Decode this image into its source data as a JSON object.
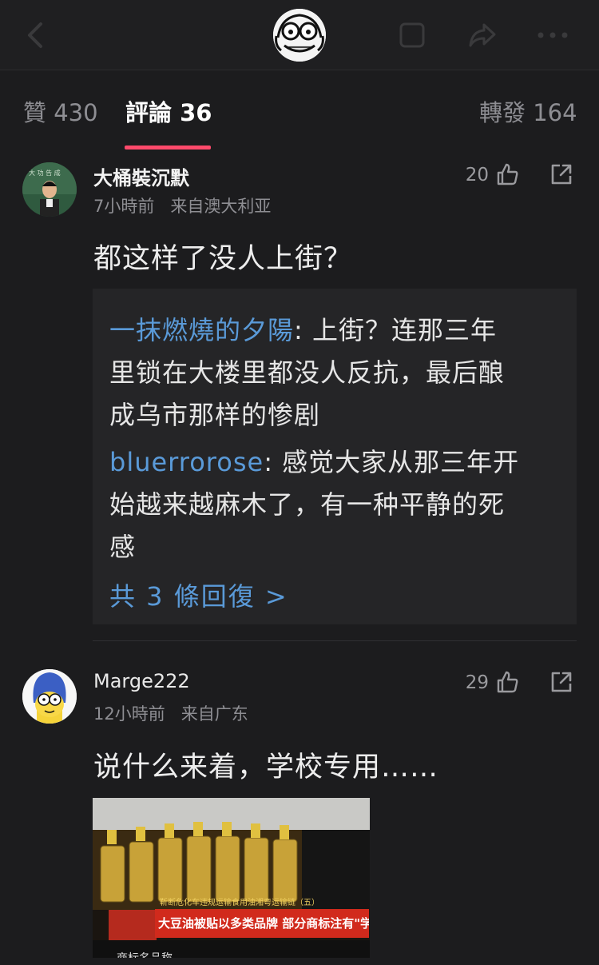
{
  "tabs": {
    "likes": "贊 430",
    "comments": "評論 36",
    "reposts": "轉發 164"
  },
  "colors": {
    "accent": "#ff4a6b",
    "link": "#5a9ad8",
    "background": "#1c1c1e"
  },
  "icons": {
    "back": "chevron-left-icon",
    "top_avatar": "cartoon-face-icon",
    "square": "square-icon",
    "share": "share-icon",
    "more": "more-dots-icon",
    "like": "thumbs-up-icon",
    "forward": "forward-icon"
  },
  "comments": [
    {
      "username": "大桶裝沉默",
      "time": "7小時前",
      "location": "来自澳大利亚",
      "likes": "20",
      "text": "都这样了没人上街？",
      "replies": [
        {
          "name": "一抹燃燒的夕陽",
          "line1": ": 上街？连那三年",
          "line2": "里锁在大楼里都没人反抗，最后酿",
          "line3": "成乌市那样的惨剧"
        },
        {
          "name": "bluerrorose",
          "line1": ": 感觉大家从那三年开",
          "line2": "始越来越麻木了，有一种平静的死",
          "line3": "感"
        }
      ],
      "more_replies": "共 3 條回復 >"
    },
    {
      "username": "Marge222",
      "time": "12小時前",
      "location": "来自广东",
      "likes": "29",
      "text": "说什么来着，学校专用……",
      "image": {
        "caption_top": "靳断危化车违规运输食用油湘粤运输链（五）",
        "caption_main": "大豆油被贴以多类品牌  部分商标注有\"学校专用\"",
        "caption_bottom": "商标名品称"
      }
    }
  ]
}
